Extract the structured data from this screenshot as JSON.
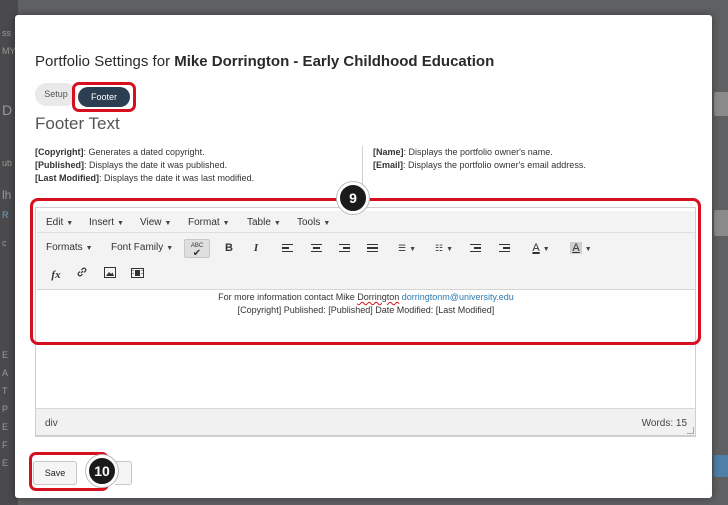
{
  "background": {
    "left_fragments": [
      "ss",
      "MY",
      "D",
      "ub",
      "lh",
      "R",
      "c",
      "E",
      "A",
      "T",
      "P",
      "E",
      "F",
      "E"
    ]
  },
  "modal": {
    "title_prefix": "Portfolio Settings for ",
    "title_bold": "Mike Dorrington - Early Childhood Education",
    "tabs": [
      {
        "label": "Setup",
        "active": false
      },
      {
        "label": "Footer",
        "active": true
      }
    ],
    "section_heading": "Footer Text",
    "legend_left": [
      {
        "token": "[Copyright]",
        "desc": ": Generates a dated copyright."
      },
      {
        "token": "[Published]",
        "desc": ": Displays the date it was published."
      },
      {
        "token": "[Last Modified]",
        "desc": ": Displays the date it was last modified."
      }
    ],
    "legend_right": [
      {
        "token": "[Name]",
        "desc": ": Displays the portfolio owner's name."
      },
      {
        "token": "[Email]",
        "desc": ": Displays the portfolio owner's email address."
      }
    ]
  },
  "editor": {
    "menus": [
      "Edit",
      "Insert",
      "View",
      "Format",
      "Table",
      "Tools"
    ],
    "toolbar_dropdowns": [
      "Formats",
      "Font Family"
    ],
    "spellcheck_label": "ABC",
    "bold_label": "B",
    "italic_label": "I",
    "text_color_label": "A",
    "bg_color_label": "A",
    "formula_label": "fx",
    "content": {
      "line1_prefix": "For more information contact Mike ",
      "line1_name": "Dorrington",
      "line1_email": "dorringtonm@university.edu",
      "line2": "[Copyright] Published: [Published] Date Modified: [Last Modified]"
    },
    "status_path": "div",
    "word_count": "Words: 15"
  },
  "badges": {
    "step9": "9",
    "step10": "10"
  },
  "actions": {
    "save_label": "Save"
  },
  "colors": {
    "highlight": "#d6101e",
    "active_tab": "#2c3e52",
    "badge": "#1b1b1b",
    "link": "#2a7ab0"
  }
}
